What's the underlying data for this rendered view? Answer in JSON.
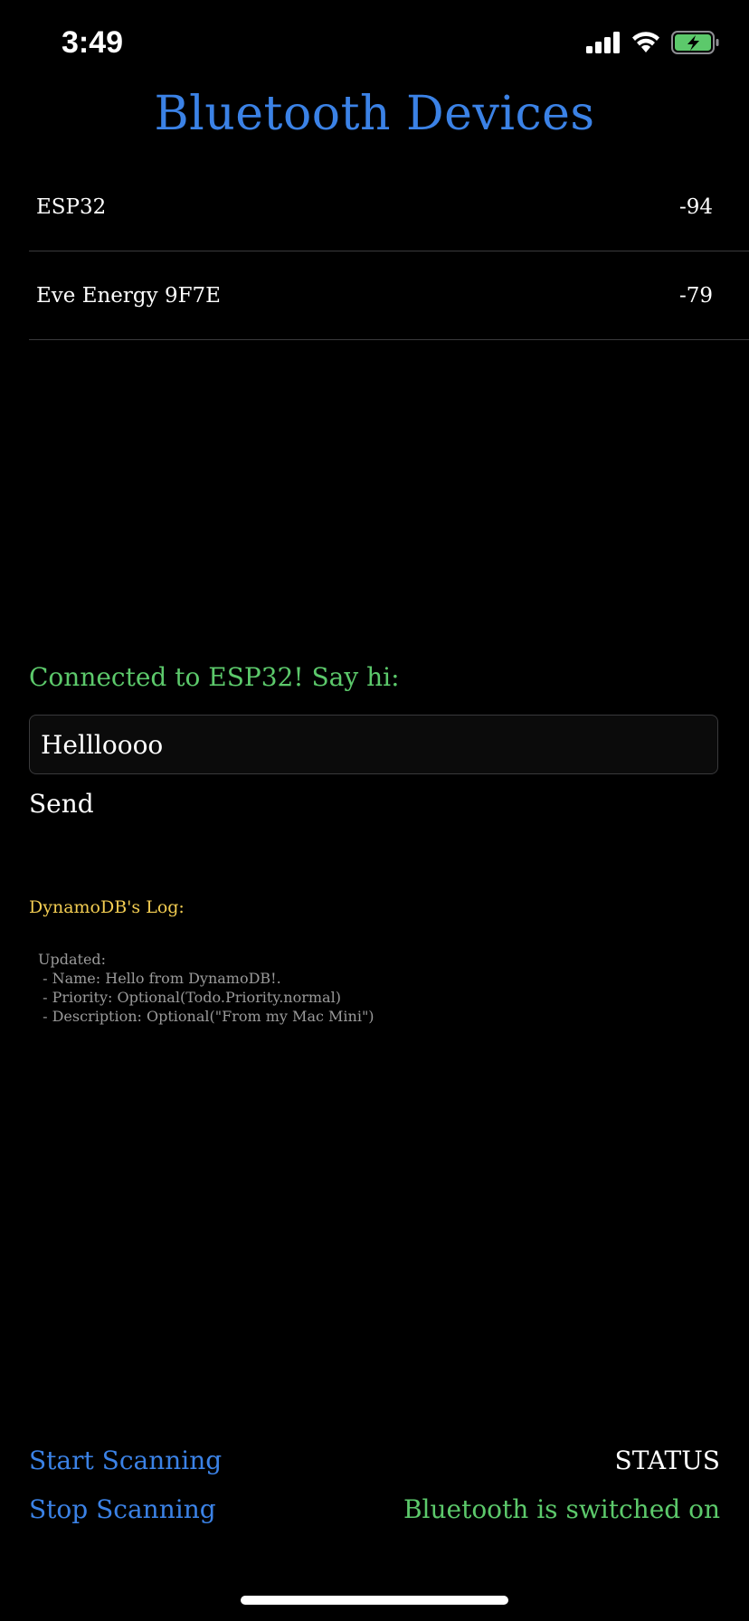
{
  "status_bar": {
    "time": "3:49",
    "icons": [
      "cellular-signal-icon",
      "wifi-icon",
      "battery-charging-icon"
    ],
    "battery_color": "#5cc96b"
  },
  "header": {
    "title": "Bluetooth Devices"
  },
  "devices": [
    {
      "name": "ESP32",
      "rssi": "-94"
    },
    {
      "name": "Eve Energy 9F7E",
      "rssi": "-79"
    }
  ],
  "connection": {
    "message": "Connected to ESP32! Say hi:",
    "input_value": "Hellloooo",
    "send_label": "Send"
  },
  "log": {
    "title": "DynamoDB's Log:",
    "body": "Updated:\n - Name: Hello from DynamoDB!.\n - Priority: Optional(Todo.Priority.normal)\n - Description: Optional(\"From my Mac Mini\")"
  },
  "controls": {
    "start_label": "Start Scanning",
    "stop_label": "Stop Scanning",
    "status_label": "STATUS",
    "status_value": "Bluetooth is switched on"
  },
  "colors": {
    "accent_blue": "#3b82e6",
    "success_green": "#5cc96b",
    "log_yellow": "#f3cd52",
    "background": "#000000"
  }
}
